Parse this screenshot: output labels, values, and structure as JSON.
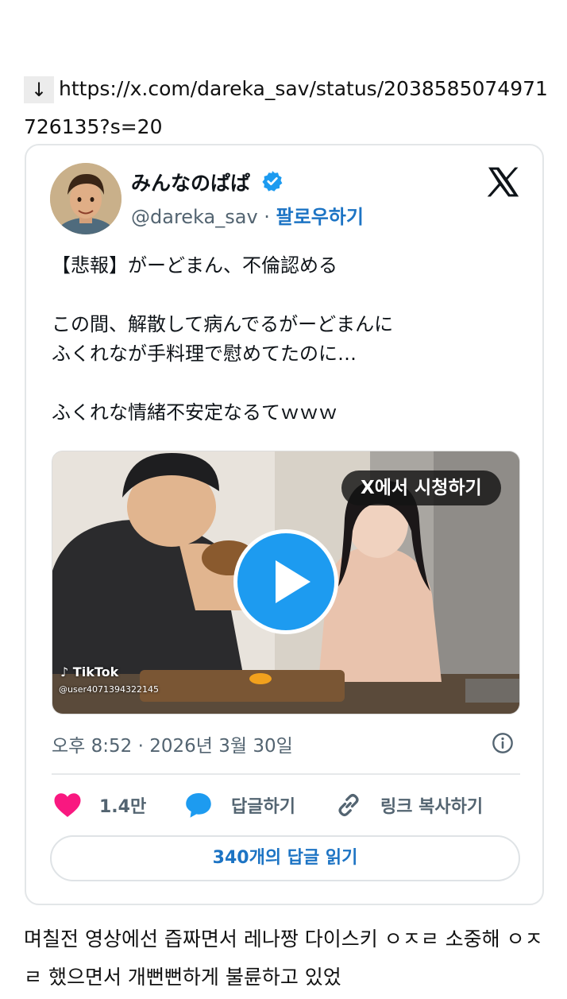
{
  "link": {
    "arrow": "↓",
    "url": "https://x.com/dareka_sav/status/2038585074971726135?s=20"
  },
  "tweet": {
    "display_name": "みんなのぱぱ",
    "handle": "@dareka_sav",
    "separator": " · ",
    "follow_label": "팔로우하기",
    "text": "【悲報】がーどまん、不倫認める\n\nこの間、解散して病んでるがーどまんに\nふくれなが手料理で慰めてたのに…\n\nふくれな情緒不安定なるてｗｗｗ",
    "video": {
      "watch_label": "X에서 시청하기",
      "tiktok_label": "TikTok",
      "tiktok_user": "@user4071394322145"
    },
    "timestamp": "오후 8:52 · 2026년 3월 30일",
    "likes": "1.4만",
    "reply_label": "답글하기",
    "copy_link_label": "링크 복사하기",
    "read_replies_label": "340개의 답글 읽기"
  },
  "caption": "며칠전 영상에선 즙짜면서 레나짱 다이스키 ㅇㅈㄹ 소중해 ㅇㅈㄹ 했으면서 개뻔뻔하게 불륜하고 있었",
  "colors": {
    "accent": "#1d9bf0",
    "link_blue": "#1d74c4",
    "like_pink": "#f91880",
    "muted_text": "#536471"
  },
  "icons": [
    "down-arrow-icon",
    "verified-badge-icon",
    "x-logo-icon",
    "play-icon",
    "tiktok-icon",
    "info-icon",
    "heart-icon",
    "reply-bubble-icon",
    "link-icon"
  ]
}
